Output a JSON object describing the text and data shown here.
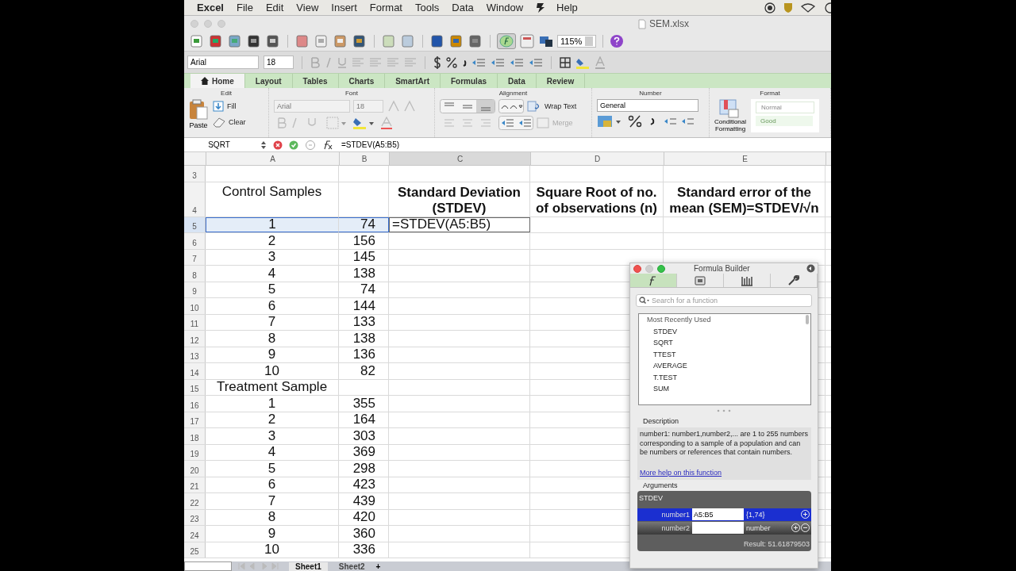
{
  "menu_bar": {
    "app": "Excel",
    "items": [
      "File",
      "Edit",
      "View",
      "Insert",
      "Format",
      "Tools",
      "Data",
      "Window",
      "Help"
    ]
  },
  "title_bar": {
    "title": "SEM.xlsx"
  },
  "toolbar": {
    "zoom": "115%"
  },
  "format_toolbar": {
    "font": "Arial",
    "size": "18"
  },
  "ribbon": {
    "tabs": [
      {
        "label": "Home",
        "selected": true
      },
      {
        "label": "Layout",
        "selected": false
      },
      {
        "label": "Tables",
        "selected": false
      },
      {
        "label": "Charts",
        "selected": false
      },
      {
        "label": "SmartArt",
        "selected": false
      },
      {
        "label": "Formulas",
        "selected": false
      },
      {
        "label": "Data",
        "selected": false
      },
      {
        "label": "Review",
        "selected": false
      }
    ],
    "groups": {
      "edit": {
        "label": "Edit",
        "paste": "Paste",
        "fill": "Fill",
        "clear": "Clear"
      },
      "font": {
        "label": "Font",
        "font": "Arial",
        "size": "18"
      },
      "alignment": {
        "label": "Alignment",
        "wrap_text": "Wrap Text",
        "merge": "Merge"
      },
      "number": {
        "label": "Number",
        "format": "General"
      },
      "format": {
        "label": "Format",
        "conditional": "Conditional\nFormatting",
        "styles": [
          "Normal",
          "Good"
        ]
      }
    }
  },
  "formula_bar": {
    "name_box": "SQRT",
    "formula": "=STDEV(A5:B5)"
  },
  "sheet": {
    "columns": [
      {
        "label": "A",
        "selected": false
      },
      {
        "label": "B",
        "selected": false
      },
      {
        "label": "C",
        "selected": true
      },
      {
        "label": "D",
        "selected": false
      },
      {
        "label": "E",
        "selected": false
      }
    ],
    "rows": [
      {
        "header": "3",
        "selected": false
      },
      {
        "header": "4",
        "selected": false,
        "a": "Control Samples",
        "c": "Standard Deviation\n(STDEV)",
        "d": "Square Root of no.\nof observations (n)",
        "e": "Standard error of the\nmean (SEM)=STDEV/√n"
      },
      {
        "header": "5",
        "selected": true,
        "a": "1",
        "b": "74",
        "c": "=STDEV(A5:B5)"
      },
      {
        "header": "6",
        "selected": false,
        "a": "2",
        "b": "156"
      },
      {
        "header": "7",
        "selected": false,
        "a": "3",
        "b": "145"
      },
      {
        "header": "8",
        "selected": false,
        "a": "4",
        "b": "138"
      },
      {
        "header": "9",
        "selected": false,
        "a": "5",
        "b": "74"
      },
      {
        "header": "10",
        "selected": false,
        "a": "6",
        "b": "144"
      },
      {
        "header": "11",
        "selected": false,
        "a": "7",
        "b": "133"
      },
      {
        "header": "12",
        "selected": false,
        "a": "8",
        "b": "138"
      },
      {
        "header": "13",
        "selected": false,
        "a": "9",
        "b": "136"
      },
      {
        "header": "14",
        "selected": false,
        "a": "10",
        "b": "82"
      },
      {
        "header": "15",
        "selected": false,
        "a": "Treatment Sample"
      },
      {
        "header": "16",
        "selected": false,
        "a": "1",
        "b": "355"
      },
      {
        "header": "17",
        "selected": false,
        "a": "2",
        "b": "164"
      },
      {
        "header": "18",
        "selected": false,
        "a": "3",
        "b": "303"
      },
      {
        "header": "19",
        "selected": false,
        "a": "4",
        "b": "369"
      },
      {
        "header": "20",
        "selected": false,
        "a": "5",
        "b": "298"
      },
      {
        "header": "21",
        "selected": false,
        "a": "6",
        "b": "423"
      },
      {
        "header": "22",
        "selected": false,
        "a": "7",
        "b": "439"
      },
      {
        "header": "23",
        "selected": false,
        "a": "8",
        "b": "420"
      },
      {
        "header": "24",
        "selected": false,
        "a": "9",
        "b": "360"
      },
      {
        "header": "25",
        "selected": false,
        "a": "10",
        "b": "336"
      }
    ]
  },
  "sheet_tabs": {
    "tabs": [
      {
        "label": "Sheet1",
        "selected": true
      },
      {
        "label": "Sheet2",
        "selected": false
      }
    ],
    "add": "+"
  },
  "formula_builder": {
    "title": "Formula Builder",
    "tabs": [
      {
        "selected": true
      },
      {
        "selected": false
      },
      {
        "selected": false
      },
      {
        "selected": false
      }
    ],
    "search": {
      "placeholder": "Search for a function"
    },
    "list_heading": "Most Recently Used",
    "functions": [
      "STDEV",
      "SQRT",
      "TTEST",
      "AVERAGE",
      "T.TEST",
      "SUM"
    ],
    "description_heading": "Description",
    "description": "number1: number1,number2,... are 1 to 255 numbers corresponding to a sample of a population and can be numbers or references that contain numbers.",
    "help_link": "More help on this function",
    "arguments_heading": "Arguments",
    "function": "STDEV",
    "arguments": [
      {
        "name": "number1",
        "value": "A5:B5",
        "result": "{1,74}",
        "selected": true
      },
      {
        "name": "number2",
        "result": "number",
        "selected": false
      }
    ],
    "result": "Result: 51.61879503"
  }
}
